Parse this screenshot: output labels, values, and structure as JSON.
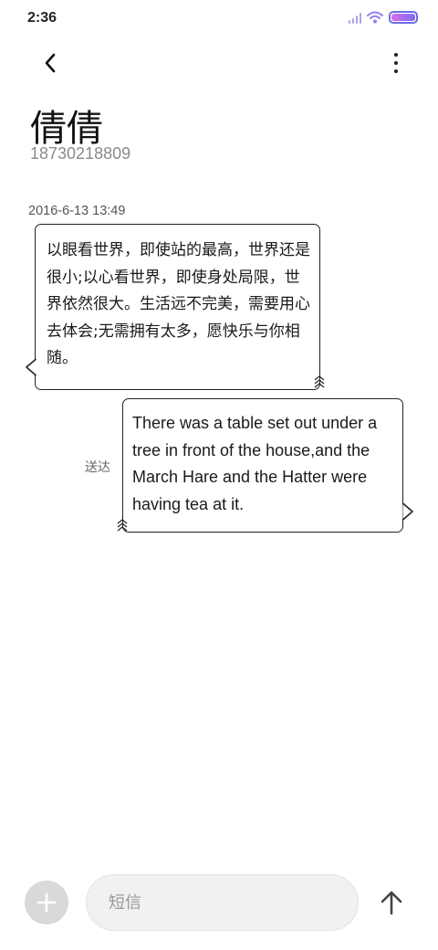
{
  "status_bar": {
    "time": "2:36"
  },
  "header": {
    "back_icon": "chevron-left-icon",
    "more_icon": "more-vertical-icon"
  },
  "contact": {
    "name": "倩倩",
    "number": "18730218809"
  },
  "conversation": {
    "timestamp": "2016-6-13 13:49",
    "messages": [
      {
        "direction": "incoming",
        "text": "以眼看世界，即使站的最高，世界还是很小;以心看世界，即使身处局限，世界依然很大。生活远不完美，需要用心去体会;无需拥有太多，愿快乐与你相随。"
      },
      {
        "direction": "outgoing",
        "text": "There was a table set out under a tree in front of the house,and the March Hare and the Hatter were having tea at it.",
        "status": "送达"
      }
    ]
  },
  "composer": {
    "placeholder": "短信",
    "add_icon": "plus-icon",
    "send_icon": "arrow-up-icon"
  },
  "colors": {
    "background": "#ffffff",
    "bubble_border": "#222222",
    "input_bg": "#f1f1f1",
    "add_button_bg": "#d9d9d9",
    "battery_accent": "#7a6ff0"
  }
}
